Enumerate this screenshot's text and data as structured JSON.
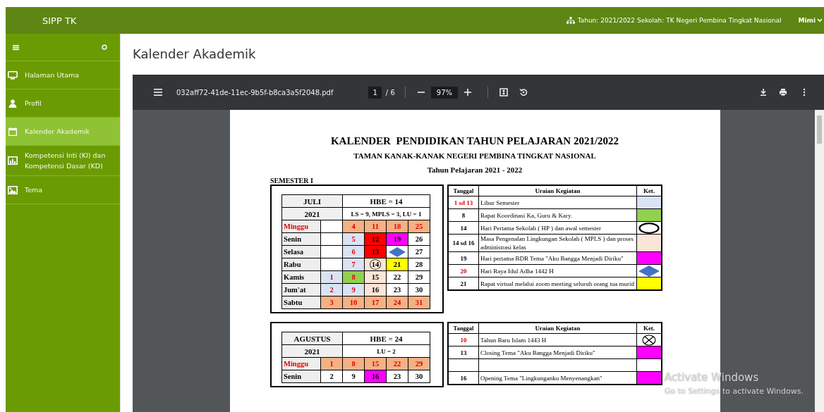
{
  "topbar": {
    "brand": "SIPP TK",
    "info": "Tahun: 2021/2022 Sekolah: TK Negeri Pembina Tingkat Nasional",
    "user": "Mimi"
  },
  "sidebar": {
    "items": [
      {
        "kind": "monitor",
        "label": "Halaman Utama",
        "selected": false
      },
      {
        "kind": "user",
        "label": "Profil",
        "selected": false
      },
      {
        "kind": "calendar",
        "label": "Kalender Akademik",
        "selected": true
      },
      {
        "kind": "chart",
        "label": "Kompetensi Inti (KI) dan Kompetensi Dasar (KD)",
        "selected": false
      },
      {
        "kind": "image",
        "label": "Tema",
        "selected": false
      }
    ]
  },
  "page_title": "Kalender Akademik",
  "pdf_viewer": {
    "filename": "032aff72-41de-11ec-9b5f-b8ca3a5f2048.pdf",
    "page": "1",
    "page_total": "/ 6",
    "zoom": "97%"
  },
  "document": {
    "title": "KALENDER  PENDIDIKAN TAHUN PELAJARAN 2021/2022",
    "subtitle": "TAMAN KANAK-KANAK NEGERI PEMBINA TINGKAT NASIONAL",
    "year_line": "Tahun Pelajaran 2021 - 2022",
    "semester": "SEMESTER I",
    "months": [
      {
        "calendar": {
          "month": "JULI",
          "year": "2021",
          "hbe": "HBE = 14",
          "summary": "LS = 9, MPLS = 3, LU = 1",
          "rows": [
            {
              "day": "Minggu",
              "red": true,
              "cells": [
                {
                  "kind": "number",
                  "color": "#ffffff"
                },
                {
                  "kind": "number",
                  "text": "4",
                  "color": "#f4b183",
                  "red": true
                },
                {
                  "kind": "number",
                  "text": "11",
                  "color": "#f4b183",
                  "red": true
                },
                {
                  "kind": "number",
                  "text": "18",
                  "color": "#f4b183",
                  "red": true
                },
                {
                  "kind": "number",
                  "text": "25",
                  "color": "#f4b183",
                  "red": true
                }
              ]
            },
            {
              "day": "Senin",
              "red": false,
              "cells": [
                {
                  "kind": "number",
                  "color": "#ffffff"
                },
                {
                  "kind": "number",
                  "text": "5",
                  "color": "#dae3f3",
                  "red": true
                },
                {
                  "kind": "number",
                  "text": "12",
                  "color": "#ff0000",
                  "red": false
                },
                {
                  "kind": "number",
                  "text": "19",
                  "color": "#ff00ff",
                  "red": false
                },
                {
                  "kind": "number",
                  "text": "26",
                  "color": "#ffffff",
                  "red": false
                }
              ]
            },
            {
              "day": "Selasa",
              "red": false,
              "cells": [
                {
                  "kind": "number",
                  "color": "#ffffff"
                },
                {
                  "kind": "number",
                  "text": "6",
                  "color": "#dae3f3",
                  "red": true
                },
                {
                  "kind": "number",
                  "text": "13",
                  "color": "#ff0000",
                  "red": false
                },
                {
                  "kind": "diamond",
                  "color": "#ffffff"
                },
                {
                  "kind": "number",
                  "text": "27",
                  "color": "#ffffff",
                  "red": false
                }
              ]
            },
            {
              "day": "Rabu",
              "red": false,
              "cells": [
                {
                  "kind": "number",
                  "color": "#ffffff"
                },
                {
                  "kind": "number",
                  "text": "7",
                  "color": "#dae3f3",
                  "red": true
                },
                {
                  "kind": "circle",
                  "text": "14",
                  "color": "#fbe5d6",
                  "red": false
                },
                {
                  "kind": "number",
                  "text": "21",
                  "color": "#ffff00",
                  "red": false
                },
                {
                  "kind": "number",
                  "text": "28",
                  "color": "#ffffff",
                  "red": false
                }
              ]
            },
            {
              "day": "Kamis",
              "red": false,
              "cells": [
                {
                  "kind": "number",
                  "text": "1",
                  "color": "#dae3f3",
                  "red": true
                },
                {
                  "kind": "number",
                  "text": "8",
                  "color": "#92d050",
                  "red": true
                },
                {
                  "kind": "number",
                  "text": "15",
                  "color": "#fbe5d6",
                  "red": false
                },
                {
                  "kind": "number",
                  "text": "22",
                  "color": "#ffffff",
                  "red": false
                },
                {
                  "kind": "number",
                  "text": "29",
                  "color": "#ffffff",
                  "red": false
                }
              ]
            },
            {
              "day": "Jum'at",
              "red": false,
              "cells": [
                {
                  "kind": "number",
                  "text": "2",
                  "color": "#dae3f3",
                  "red": true
                },
                {
                  "kind": "number",
                  "text": "9",
                  "color": "#dae3f3",
                  "red": true
                },
                {
                  "kind": "number",
                  "text": "16",
                  "color": "#fbe5d6",
                  "red": false
                },
                {
                  "kind": "number",
                  "text": "23",
                  "color": "#ffffff",
                  "red": false
                },
                {
                  "kind": "number",
                  "text": "30",
                  "color": "#ffffff",
                  "red": false
                }
              ]
            },
            {
              "day": "Sabtu",
              "red": false,
              "cells": [
                {
                  "kind": "number",
                  "text": "3",
                  "color": "#f4b183",
                  "red": true
                },
                {
                  "kind": "number",
                  "text": "10",
                  "color": "#f4b183",
                  "red": true
                },
                {
                  "kind": "number",
                  "text": "17",
                  "color": "#f4b183",
                  "red": true
                },
                {
                  "kind": "number",
                  "text": "24",
                  "color": "#f4b183",
                  "red": true
                },
                {
                  "kind": "number",
                  "text": "31",
                  "color": "#f4b183",
                  "red": true
                }
              ]
            }
          ]
        },
        "events": {
          "columns": [
            "Tanggal",
            "Uraian  Kegiatan",
            "Ket."
          ],
          "rows": [
            {
              "date": "1 sd 13",
              "red": true,
              "text": "Libur Semester",
              "ket": {
                "kind": "swatch",
                "color": "#dae3f3"
              }
            },
            {
              "date": "8",
              "red": false,
              "text": "Rapat Koordinasi Ka, Guru & Kary.",
              "ket": {
                "kind": "swatch",
                "color": "#92d050"
              }
            },
            {
              "date": "14",
              "red": false,
              "text": "Hari Pertama Sekolah ( HP ) dan awal semester",
              "ket": {
                "kind": "oval",
                "color": "#ffffff"
              }
            },
            {
              "date": "14 sd 16",
              "red": false,
              "text": "Masa Pengenalan Lingkungan Sekolah ( MPLS ) dan proses administrasi kelas",
              "ket": {
                "kind": "swatch",
                "color": "#fbe5d6"
              }
            },
            {
              "date": "19",
              "red": false,
              "text": "Hari pertama BDR Tema \"Aku Bangga Menjadi Diriku\"",
              "ket": {
                "kind": "swatch",
                "color": "#ff00ff"
              }
            },
            {
              "date": "20",
              "red": true,
              "text": "Hari Raya Idul Adha 1442 H",
              "ket": {
                "kind": "diamond",
                "color": "#ffffff"
              }
            },
            {
              "date": "21",
              "red": false,
              "text": "Rapat virtual melalui zoom meeting seluruh orang tua murid",
              "ket": {
                "kind": "swatch",
                "color": "#ffff00"
              }
            }
          ]
        }
      },
      {
        "calendar": {
          "month": "AGUSTUS",
          "year": "2021",
          "hbe": "HBE = 24",
          "summary": "LU = 2",
          "rows": [
            {
              "day": "Minggu",
              "red": true,
              "cells": [
                {
                  "kind": "number",
                  "text": "1",
                  "color": "#f4b183",
                  "red": true
                },
                {
                  "kind": "number",
                  "text": "8",
                  "color": "#f4b183",
                  "red": true
                },
                {
                  "kind": "number",
                  "text": "15",
                  "color": "#f4b183",
                  "red": true
                },
                {
                  "kind": "number",
                  "text": "22",
                  "color": "#f4b183",
                  "red": true
                },
                {
                  "kind": "number",
                  "text": "29",
                  "color": "#f4b183",
                  "red": true
                }
              ]
            },
            {
              "day": "Senin",
              "red": false,
              "cells": [
                {
                  "kind": "number",
                  "text": "2",
                  "color": "#ffffff",
                  "red": false
                },
                {
                  "kind": "number",
                  "text": "9",
                  "color": "#ffffff",
                  "red": false
                },
                {
                  "kind": "number",
                  "text": "16",
                  "color": "#ff00ff",
                  "red": false
                },
                {
                  "kind": "number",
                  "text": "23",
                  "color": "#ffffff",
                  "red": false
                },
                {
                  "kind": "number",
                  "text": "30",
                  "color": "#ffffff",
                  "red": false
                }
              ]
            }
          ]
        },
        "events": {
          "columns": [
            "Tanggal",
            "Uraian  Kegiatan",
            "Ket."
          ],
          "rows": [
            {
              "date": "10",
              "red": true,
              "text": "Tahun Baru Islam 1443 H",
              "ket": {
                "kind": "crossed",
                "color": "#ffffff"
              }
            },
            {
              "date": "13",
              "red": false,
              "text": "Closing Tema \"Aku Bangga Menjadi Diriku\"",
              "ket": {
                "kind": "swatch",
                "color": "#ff00ff"
              }
            },
            {
              "ket": {
                "kind": "swatch",
                "color": "#ffffff"
              }
            },
            {
              "date": "16",
              "red": false,
              "text": "Opening Tema \"Lingkunganku Menyenangkan\"",
              "ket": {
                "kind": "swatch",
                "color": "#ff00ff"
              }
            }
          ]
        }
      }
    ]
  },
  "os_overlay": {
    "title": "Activate Windows",
    "subtitle": "Go to Settings to activate Windows."
  }
}
